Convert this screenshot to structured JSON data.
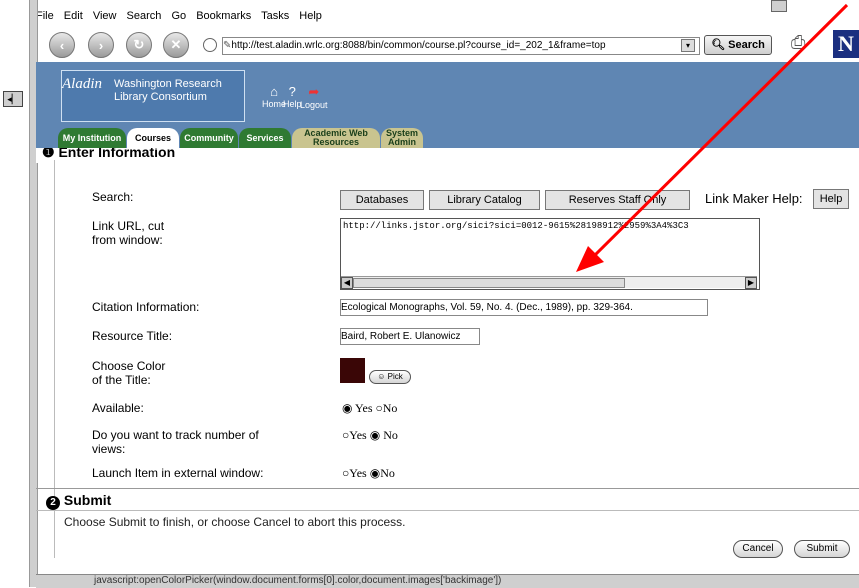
{
  "browser": {
    "menu": [
      "File",
      "Edit",
      "View",
      "Search",
      "Go",
      "Bookmarks",
      "Tasks",
      "Help"
    ],
    "url": "http://test.aladin.wrlc.org:8088/bin/common/course.pl?course_id=_202_1&frame=top",
    "search_label": "Search",
    "logo_letter": "N"
  },
  "header": {
    "logo_script": "Aladin",
    "org_line1": "Washington Research",
    "org_line2": "Library Consortium",
    "icons": [
      {
        "label": "Home",
        "icon": "home-icon"
      },
      {
        "label": "Help",
        "icon": "help-icon"
      },
      {
        "label": "Logout",
        "icon": "logout-icon"
      }
    ],
    "tabs": [
      {
        "label": "My Institution"
      },
      {
        "label": "Courses"
      },
      {
        "label": "Community"
      },
      {
        "label": "Services"
      },
      {
        "label": "Academic Web Resources"
      },
      {
        "label": "System Admin"
      }
    ]
  },
  "form": {
    "section1": "Enter Information",
    "search_label": "Search:",
    "search_buttons": [
      "Databases",
      "Library Catalog",
      "Reserves Staff Only"
    ],
    "link_maker_help_label": "Link Maker Help:",
    "help_button": "Help",
    "link_url_label_1": "Link URL, cut",
    "link_url_label_2": "from window:",
    "link_url_value": "http://links.jstor.org/sici?sici=0012-9615%28198912%2959%3A4%3C3",
    "citation_label": "Citation Information:",
    "citation_value": "Ecological Monographs, Vol. 59, No. 4. (Dec., 1989), pp. 329-364.",
    "title_label": "Resource Title:",
    "title_value": "Baird, Robert E. Ulanowicz",
    "color_label_1": "Choose Color",
    "color_label_2": "of the Title:",
    "color_value": "#3a0606",
    "pick_label": "Pick",
    "available_label": "Available:",
    "track_label_1": "Do you want to track number of",
    "track_label_2": "views:",
    "launch_label": "Launch Item in external window:",
    "yes": "Yes",
    "no": "No",
    "section2_num": "2",
    "section2": "Submit",
    "submit_hint": "Choose Submit to finish, or choose Cancel to abort this process.",
    "cancel": "Cancel",
    "submit": "Submit"
  },
  "status": {
    "text": "javascript:openColorPicker(window.document.forms[0].color,document.images['backimage'])"
  },
  "colors": {
    "header": "#5f86b3",
    "arrow": "#ff0000",
    "accent_green": "#2f7a32"
  }
}
